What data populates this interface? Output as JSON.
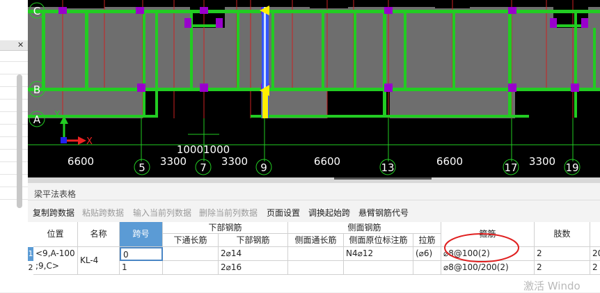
{
  "cad": {
    "axis_rows": [
      "C",
      "B",
      "A"
    ],
    "axis_x_label": "X",
    "axis_y_label": "Y",
    "overlap_dims": "10001000",
    "bottom_dims": [
      "6600",
      "3300",
      "3300",
      "6600",
      "6600",
      "3300"
    ],
    "axis_cols": [
      "5",
      "7",
      "9",
      "13",
      "17",
      "19"
    ],
    "colors": {
      "background": "#000000",
      "beam": "#22cc22",
      "column": "#9900cc",
      "grid": "#cc2222",
      "slab": "#6e6e6e",
      "selected": "#ffee00",
      "dim": "#ffffff"
    }
  },
  "panel": {
    "title": "梁平法表格",
    "toolbar": [
      {
        "label": "复制跨数据",
        "enabled": true
      },
      {
        "label": "粘贴跨数据",
        "enabled": false
      },
      {
        "label": "输入当前列数据",
        "enabled": false
      },
      {
        "label": "删除当前列数据",
        "enabled": false
      },
      {
        "label": "页面设置",
        "enabled": true
      },
      {
        "label": "调换起始跨",
        "enabled": true
      },
      {
        "label": "悬臂钢筋代号",
        "enabled": true
      }
    ]
  },
  "table": {
    "h_position": "位置",
    "h_name": "名称",
    "h_span": "跨号",
    "h_lower_group": "下部钢筋",
    "h_lower_through": "下通长筋",
    "h_lower_bar": "下部钢筋",
    "h_side_group": "侧面钢筋",
    "h_side_through": "侧面通长筋",
    "h_side_original": "侧面原位标注筋",
    "h_tie": "拉筋",
    "h_stirrup": "箍筋",
    "h_legs": "肢数",
    "row_numbers": [
      "1",
      "2"
    ],
    "position_line1": "<9,A-100",
    "position_line2": ";9,C>",
    "name": "KL-4",
    "rows": [
      {
        "span": "0",
        "lower_through": "",
        "lower_bar": "2⌀14",
        "side_through": "",
        "side_original": "N4⌀12",
        "tie": "(⌀6)",
        "stirrup": "⌀8@100(2)",
        "legs": "2",
        "extra": "20"
      },
      {
        "span": "1",
        "lower_through": "",
        "lower_bar": "2⌀16",
        "side_through": "",
        "side_original": "",
        "tie": "",
        "stirrup": "⌀8@100/200(2)",
        "legs": "2",
        "extra": "2"
      }
    ]
  },
  "watermark": "激活 Windo"
}
